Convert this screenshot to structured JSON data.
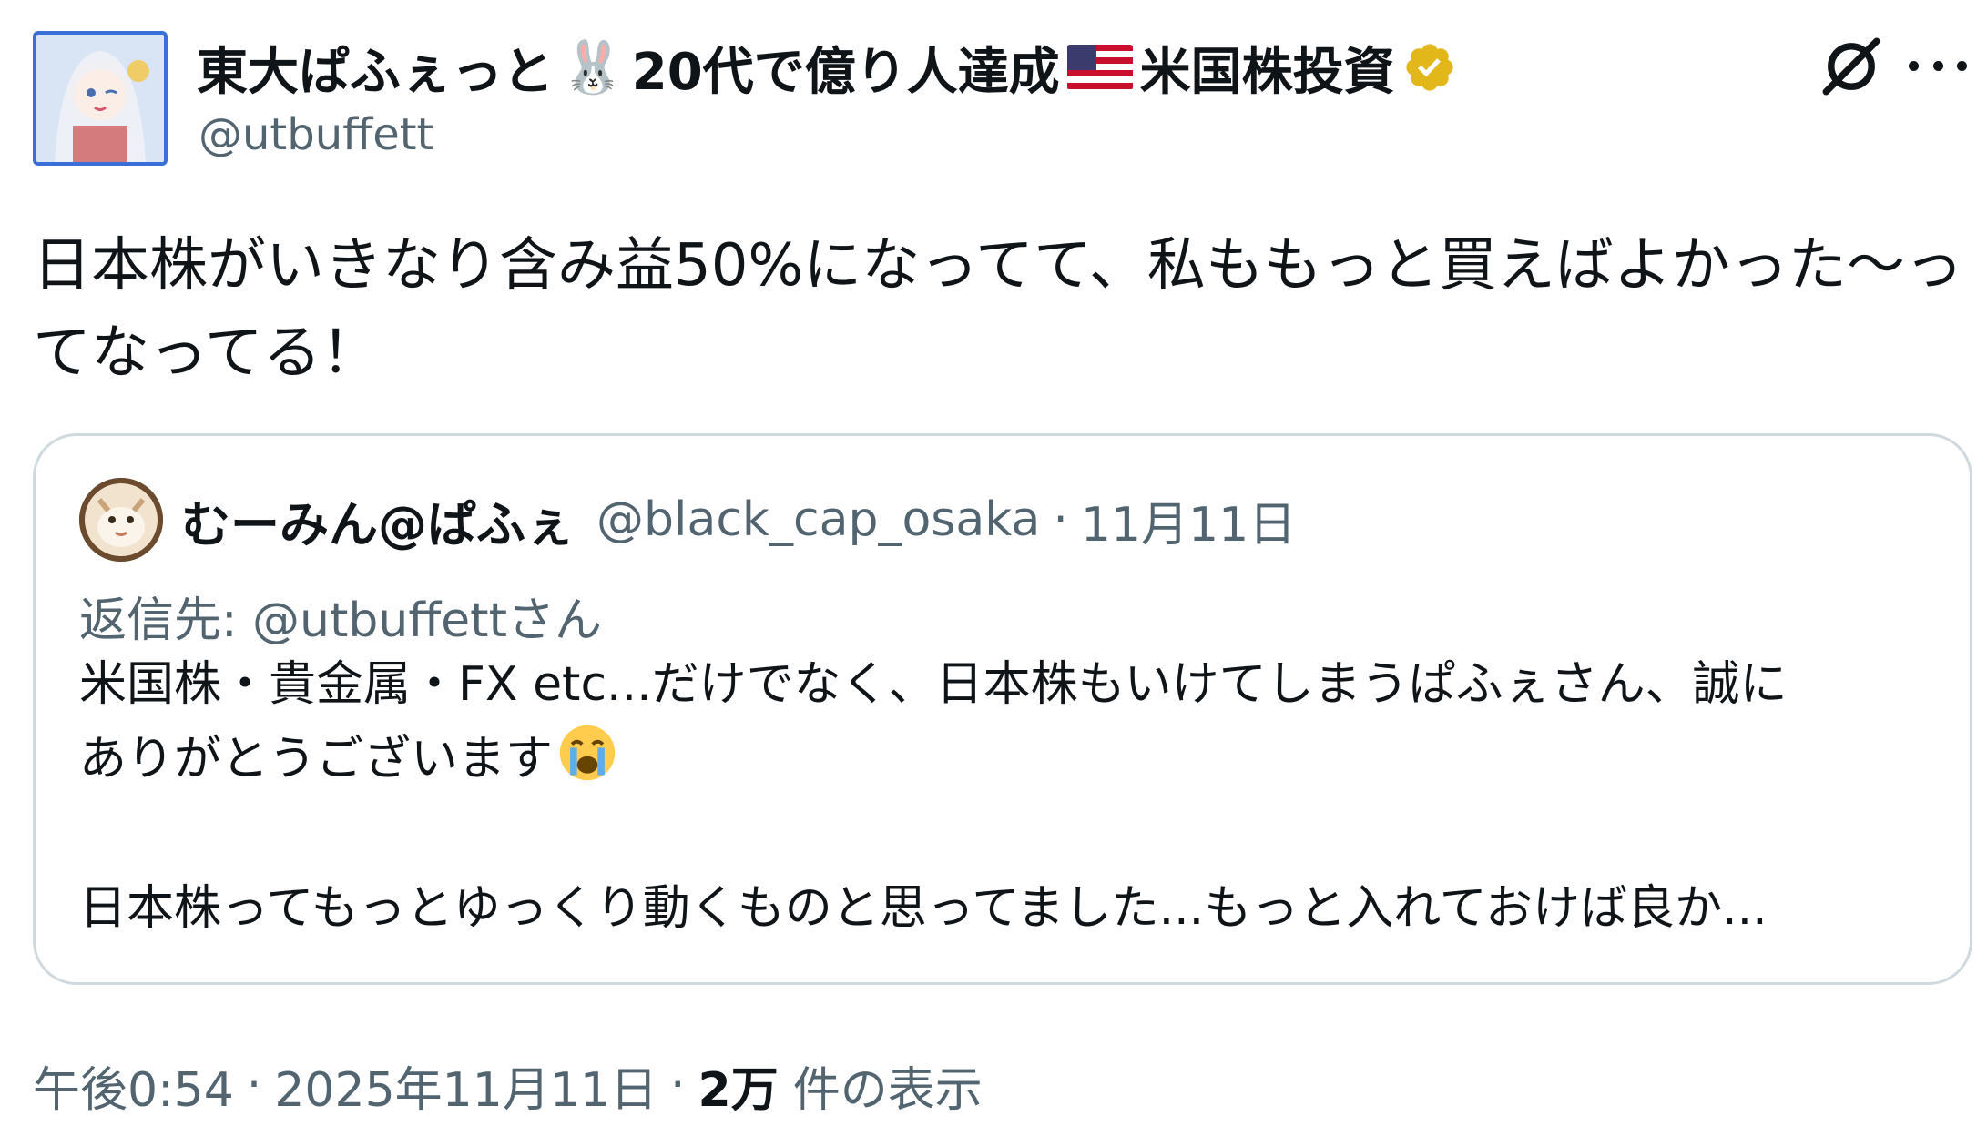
{
  "author": {
    "name_part1": "東大ぱふぇっと",
    "name_emoji_rabbit": "🐰",
    "name_part2": "20代で億り人達成",
    "name_emoji_flag": "US-flag",
    "name_part3": "米国株投資",
    "handle": "@utbuffett",
    "verified_color": "#e2b719"
  },
  "tweet": {
    "text_line1": "日本株がいきなり含み益50%になってて、私ももっと買えばよかった〜っ",
    "text_line2": "てなってる！"
  },
  "quote": {
    "name": "むーみん@ぱふぇ",
    "handle": "@black_cap_osaka",
    "separator": "·",
    "date": "11月11日",
    "reply_to": "返信先: @utbuffettさん",
    "body_line1": "米国株・貴金属・FX etc...だけでなく、日本株もいけてしまうぱふぇさん、誠に",
    "body_line2": "ありがとうございます",
    "body_line3": "日本株ってもっとゆっくり動くものと思ってました...もっと入れておけば良か..."
  },
  "meta": {
    "time": "午後0:54",
    "sep1": "·",
    "date": "2025年11月11日",
    "sep2": "·",
    "views_count": "2万",
    "views_label": "件の表示"
  },
  "icons": [
    "grok-icon",
    "more-icon",
    "verified-badge-icon",
    "crying-face-emoji-icon"
  ],
  "colors": {
    "text": "#0f1419",
    "secondary": "#536471",
    "border": "#cfd9de",
    "avatar_border": "#3b6fd8"
  }
}
